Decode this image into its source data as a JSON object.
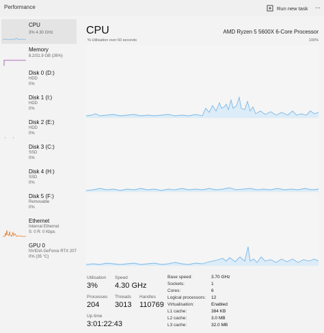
{
  "app": {
    "title": "Performance",
    "run_new_task": "Run new task",
    "more": "..."
  },
  "sidebar": {
    "items": [
      {
        "name": "CPU",
        "sub1": "3% 4.30 GHz"
      },
      {
        "name": "Memory",
        "sub1": "8.2/31.9 GB (26%)"
      },
      {
        "name": "Disk 0 (D:)",
        "sub1": "HDD",
        "sub2": "0%"
      },
      {
        "name": "Disk 1 (I:)",
        "sub1": "HDD",
        "sub2": "0%"
      },
      {
        "name": "Disk 2 (E:)",
        "sub1": "HDD",
        "sub2": "0%"
      },
      {
        "name": "Disk 3 (C:)",
        "sub1": "SSD",
        "sub2": "0%"
      },
      {
        "name": "Disk 4 (H:)",
        "sub1": "SSD",
        "sub2": "0%"
      },
      {
        "name": "Disk 5 (F:)",
        "sub1": "Removable",
        "sub2": "0%"
      },
      {
        "name": "Ethernet",
        "sub1": "Internal Ethernet",
        "sub2": "S: 0 R: 0 Kbps"
      },
      {
        "name": "GPU 0",
        "sub1": "NVIDIA GeForce RTX 207",
        "sub2": "0% (35 °C)"
      }
    ]
  },
  "main": {
    "title": "CPU",
    "model": "AMD Ryzen 5 5600X 6-Core Processor",
    "util_label": "% Utilisation over 60 seconds",
    "util_max": "100%"
  },
  "stats": {
    "utilisation": {
      "label": "Utilisation",
      "value": "3%"
    },
    "speed": {
      "label": "Speed",
      "value": "4.30 GHz"
    },
    "processes": {
      "label": "Processes",
      "value": "204"
    },
    "threads": {
      "label": "Threads",
      "value": "3013"
    },
    "handles": {
      "label": "Handles",
      "value": "110769"
    },
    "uptime": {
      "label": "Up time",
      "value": "3:01:22:43"
    }
  },
  "specs": [
    {
      "key": "Base speed:",
      "value": "3.70 GHz"
    },
    {
      "key": "Sockets:",
      "value": "1"
    },
    {
      "key": "Cores:",
      "value": "6"
    },
    {
      "key": "Logical processors:",
      "value": "12"
    },
    {
      "key": "Virtualisation:",
      "value": "Enabled"
    },
    {
      "key": "L1 cache:",
      "value": "384 KB"
    },
    {
      "key": "L2 cache:",
      "value": "3.0 MB"
    },
    {
      "key": "L3 cache:",
      "value": "32.0 MB"
    }
  ],
  "colors": {
    "cpu_line": "#7ab8e6",
    "cpu_fill": "#dcecf8",
    "memory_line": "#9b3fb0",
    "disk_line": "#5fa84a",
    "ethernet_line": "#e07b2a"
  }
}
